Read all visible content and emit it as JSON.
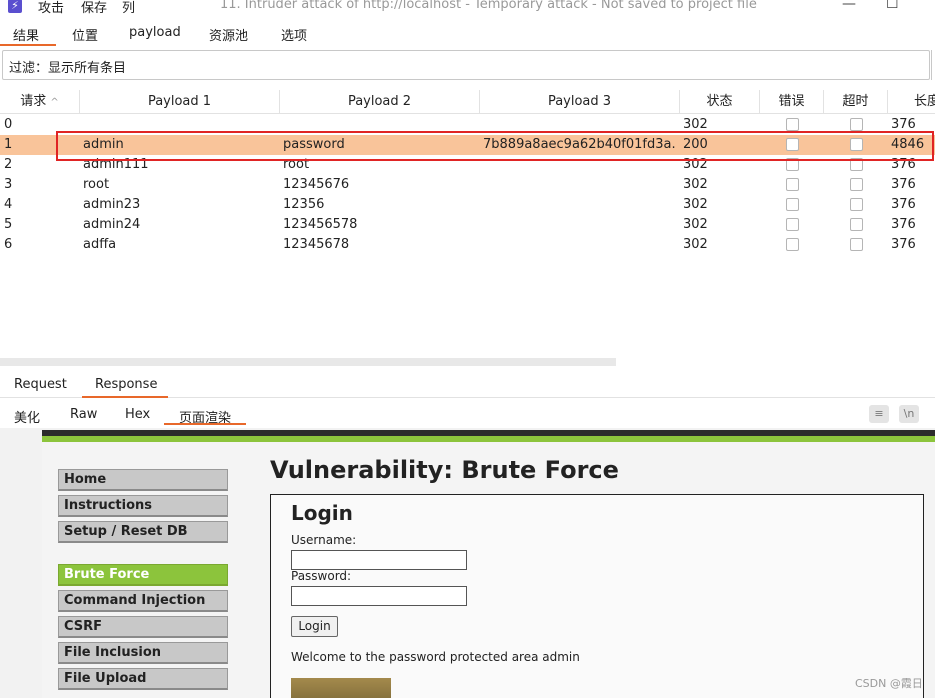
{
  "titlebar": {
    "app_icon": "lightning-icon",
    "menu": [
      "攻击",
      "保存",
      "列"
    ],
    "title": "11. Intruder attack of http://localhost - Temporary attack - Not saved to project file",
    "window_buttons": {
      "minimize": "—",
      "maximize": "☐",
      "close": "✕"
    }
  },
  "result_tabs": [
    "结果",
    "位置",
    "payload",
    "资源池",
    "选项"
  ],
  "filter": {
    "text": "过滤：显示所有条目"
  },
  "table": {
    "columns": [
      "请求",
      "Payload 1",
      "Payload 2",
      "Payload 3",
      "状态",
      "错误",
      "超时",
      "长度"
    ],
    "sort_indicator": "^",
    "rows": [
      {
        "req": "0",
        "p1": "",
        "p2": "",
        "p3": "",
        "status": "302",
        "length": "376",
        "selected": false
      },
      {
        "req": "1",
        "p1": "admin",
        "p2": "password",
        "p3": "7b889a8aec9a62b40f01fd3a...",
        "status": "200",
        "length": "4846",
        "selected": true
      },
      {
        "req": "2",
        "p1": "admin111",
        "p2": "root",
        "p3": "",
        "status": "302",
        "length": "376",
        "selected": false
      },
      {
        "req": "3",
        "p1": "root",
        "p2": "12345676",
        "p3": "",
        "status": "302",
        "length": "376",
        "selected": false
      },
      {
        "req": "4",
        "p1": "admin23",
        "p2": "12356",
        "p3": "",
        "status": "302",
        "length": "376",
        "selected": false
      },
      {
        "req": "5",
        "p1": "admin24",
        "p2": "123456578",
        "p3": "",
        "status": "302",
        "length": "376",
        "selected": false
      },
      {
        "req": "6",
        "p1": "adffa",
        "p2": "12345678",
        "p3": "",
        "status": "302",
        "length": "376",
        "selected": false
      }
    ]
  },
  "rr_tabs": [
    "Request",
    "Response"
  ],
  "view_tabs": [
    "美化",
    "Raw",
    "Hex",
    "页面渲染"
  ],
  "view_tools": [
    "wrap-icon",
    "newline-icon"
  ],
  "view_tool_labels": {
    "wrap": "≡",
    "newline": "\\n"
  },
  "render": {
    "nav": [
      "Home",
      "Instructions",
      "Setup / Reset DB",
      "Brute Force",
      "Command Injection",
      "CSRF",
      "File Inclusion",
      "File Upload"
    ],
    "title": "Vulnerability: Brute Force",
    "login_title": "Login",
    "username_label": "Username:",
    "password_label": "Password:",
    "login_button": "Login",
    "welcome": "Welcome to the password protected area admin"
  },
  "watermark": "CSDN @霞日"
}
